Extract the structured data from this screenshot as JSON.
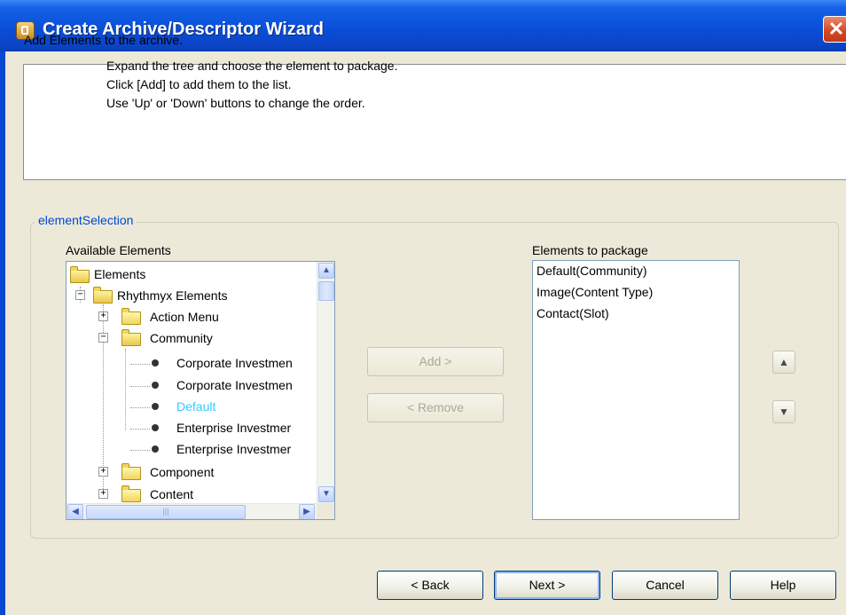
{
  "window": {
    "title": "Create Archive/Descriptor Wizard",
    "close_glyph": "✕"
  },
  "header": {
    "line1": "Add Elements to the archive.",
    "line2": "Expand the tree and choose the element to package.",
    "line3": "Click [Add] to add them to the list.",
    "line4": "Use 'Up' or 'Down' buttons to change the order."
  },
  "group": {
    "legend": "elementSelection"
  },
  "available": {
    "label": "Available Elements",
    "tree": {
      "root": "Elements",
      "rhythmyx": "Rhythmyx Elements",
      "action_menu": "Action Menu",
      "community": "Community",
      "leaf1": "Corporate Investmen",
      "leaf2": "Corporate Investmen",
      "leaf3": "Default",
      "leaf4": "Enterprise Investmer",
      "leaf5": "Enterprise Investmer",
      "component": "Component",
      "content": "Content"
    },
    "selected_color": "#33ccff"
  },
  "middle": {
    "add_label": "Add >",
    "remove_label": "< Remove"
  },
  "package": {
    "label": "Elements to package",
    "items": [
      "Default(Community)",
      "Image(Content Type)",
      "Contact(Slot)"
    ]
  },
  "order": {
    "up_glyph": "▲",
    "down_glyph": "▼"
  },
  "footer": {
    "back_label": "< Back",
    "next_label": "Next >",
    "cancel_label": "Cancel",
    "help_label": "Help"
  },
  "glyphs": {
    "plus": "+",
    "minus": "−",
    "scroll_up": "▲",
    "scroll_down": "▼",
    "scroll_left": "◀",
    "scroll_right": "▶",
    "grip": "|||"
  }
}
